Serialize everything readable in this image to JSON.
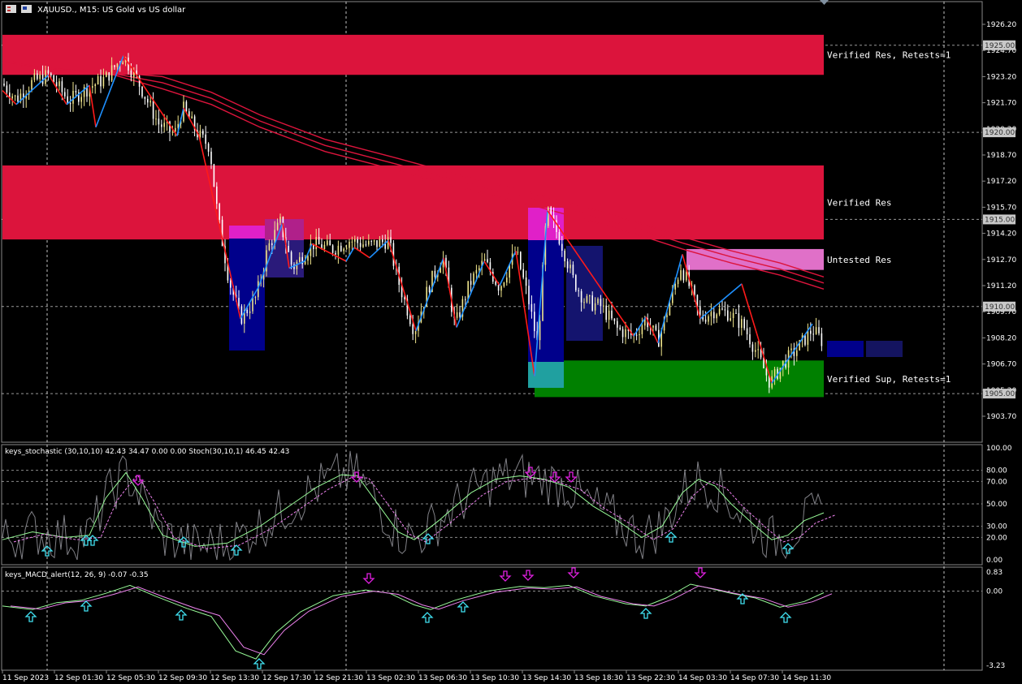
{
  "title": "XAUUSD., M15:  US Gold vs US dollar",
  "colors": {
    "background": "#000000",
    "resistance": "#dc143c",
    "untested": "#e070c8",
    "support": "#008000",
    "bull_candle": "#f0e68c",
    "bear_candle": "#ffffff",
    "zigzag_up": "#1e90ff",
    "zigzag_down": "#ff1a1a",
    "ma": "#dc143c",
    "box_navy": "#00008b",
    "box_magenta": "#e020c8",
    "stoch_main": "#98fb98",
    "stoch_signal": "#ee82ee",
    "stoch_raw": "#a0a0a8",
    "arrow_up": "#40e0f0",
    "arrow_down": "#e020e0",
    "macd_main": "#98fb98",
    "macd_signal": "#ee82ee"
  },
  "zones": [
    {
      "label": "Verified Res, Retests=1",
      "top": 1925.6,
      "bottom": 1923.3,
      "color": "resistance"
    },
    {
      "label": "Verified Res",
      "top": 1918.1,
      "bottom": 1913.85,
      "color": "resistance"
    },
    {
      "label": "Untested Res",
      "top": 1913.3,
      "bottom": 1912.1,
      "color": "untested"
    },
    {
      "label": "Verified Sup, Retests=1",
      "top": 1906.9,
      "bottom": 1904.8,
      "color": "support"
    }
  ],
  "price_ticks": [
    "1926.20",
    "1924.70",
    "1923.20",
    "1921.70",
    "1920.20",
    "1918.70",
    "1917.20",
    "1915.70",
    "1914.20",
    "1912.70",
    "1911.20",
    "1909.70",
    "1908.20",
    "1906.70",
    "1905.20",
    "1903.70"
  ],
  "price_levels": [
    "1925.00",
    "1920.00",
    "1915.00",
    "1910.00",
    "1905.00"
  ],
  "time_labels": [
    "11 Sep 2023",
    "12 Sep 01:30",
    "12 Sep 05:30",
    "12 Sep 09:30",
    "12 Sep 13:30",
    "12 Sep 17:30",
    "12 Sep 21:30",
    "13 Sep 02:30",
    "13 Sep 06:30",
    "13 Sep 10:30",
    "13 Sep 14:30",
    "13 Sep 18:30",
    "13 Sep 22:30",
    "14 Sep 03:30",
    "14 Sep 07:30",
    "14 Sep 11:30"
  ],
  "stochastic": {
    "label": "keys_stochastic (30,10,10) 42.43 34.47 0.00 0.00 Stoch(30,10,1) 46.45 42.43",
    "ticks": [
      "100.00",
      "80.00",
      "70.00",
      "50.00",
      "30.00",
      "20.00",
      "0.00"
    ]
  },
  "macd": {
    "label": "keys_MACD_alert(12, 26, 9) -0.07 -0.35",
    "ticks": [
      "0.83",
      "0.00",
      "-3.23"
    ]
  },
  "chart_data": [
    {
      "type": "line",
      "name": "XAUUSD M15 close (approx.)",
      "x": [
        "11 Sep 2023",
        "12 Sep 01:30",
        "12 Sep 05:30",
        "12 Sep 09:30",
        "12 Sep 13:30",
        "12 Sep 17:30",
        "12 Sep 21:30",
        "13 Sep 02:30",
        "13 Sep 06:30",
        "13 Sep 10:30",
        "13 Sep 14:30",
        "13 Sep 18:30",
        "13 Sep 22:30",
        "14 Sep 03:30",
        "14 Sep 07:30",
        "14 Sep 11:30"
      ],
      "values": [
        1922.8,
        1922.3,
        1924.3,
        1920.0,
        1909.8,
        1913.4,
        1913.6,
        1908.8,
        1911.8,
        1912.2,
        1915.0,
        1910.1,
        1908.6,
        1912.6,
        1906.0,
        1907.9
      ],
      "ylim": [
        1902.5,
        1927.0
      ]
    },
    {
      "type": "line",
      "name": "keys_stochastic",
      "series": [
        {
          "values": [
            18,
            22,
            78,
            25,
            12,
            30,
            75,
            20,
            40,
            72,
            70,
            45,
            18,
            72,
            15,
            42
          ]
        }
      ],
      "ylim": [
        0,
        100
      ]
    },
    {
      "type": "line",
      "name": "keys_MACD_alert",
      "series": [
        {
          "values": [
            -0.5,
            -0.3,
            0.4,
            -0.5,
            -2.7,
            -0.4,
            0.1,
            -0.8,
            0.2,
            0.4,
            0.3,
            -0.4,
            -0.6,
            0.5,
            -0.6,
            -0.07
          ]
        }
      ],
      "ylim": [
        -3.23,
        0.83
      ]
    }
  ]
}
